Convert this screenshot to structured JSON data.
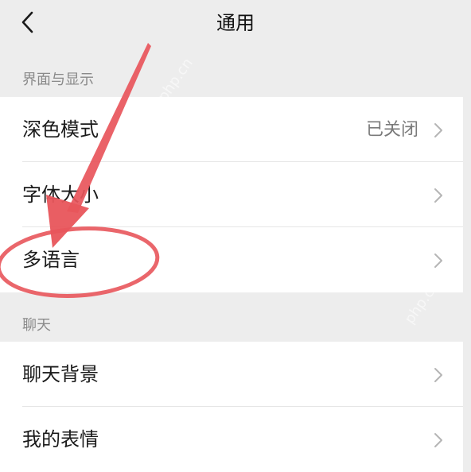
{
  "header": {
    "title": "通用",
    "back_icon": "chevron-left-icon"
  },
  "sections": [
    {
      "label": "界面与显示",
      "items": [
        {
          "label": "深色模式",
          "value": "已关闭"
        },
        {
          "label": "字体大小",
          "value": ""
        },
        {
          "label": "多语言",
          "value": ""
        }
      ]
    },
    {
      "label": "聊天",
      "items": [
        {
          "label": "聊天背景",
          "value": ""
        },
        {
          "label": "我的表情",
          "value": ""
        }
      ]
    }
  ],
  "annotation": {
    "color": "#e8555b",
    "highlighted_item": "多语言"
  },
  "watermark": "php.cn"
}
